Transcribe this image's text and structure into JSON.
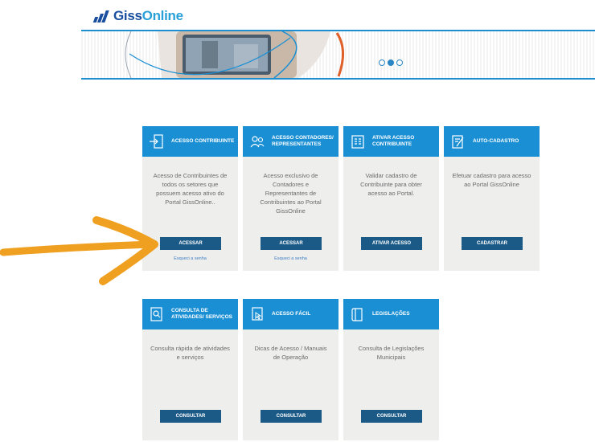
{
  "logo": {
    "brand_a": "Giss",
    "brand_b": "Online"
  },
  "carousel": {
    "slides": 3,
    "active_slide": 2
  },
  "cards": [
    {
      "title": "ACESSO CONTRIBUINTE",
      "desc": "Acesso de Contribuintes de todos os setores que possuem acesso ativo do Portal GissOnline..",
      "button": "ACESSAR",
      "link": "Esqueci a senha",
      "icon": "login-door-icon"
    },
    {
      "title": "ACESSO CONTADORES/ REPRESENTANTES",
      "desc": "Acesso exclusivo de Contadores e Representantes de Contribuintes ao Portal GissOnline",
      "button": "ACESSAR",
      "link": "Esqueci a senha",
      "icon": "users-icon"
    },
    {
      "title": "ATIVAR ACESSO CONTRIBUINTE",
      "desc": "Validar cadastro de Contribuinte para obter acesso ao Portal.",
      "button": "ATIVAR ACESSO",
      "link": "",
      "icon": "building-icon"
    },
    {
      "title": "AUTO-CADASTRO",
      "desc": "Efetuar cadastro para acesso ao Portal GissOnline",
      "button": "CADASTRAR",
      "link": "",
      "icon": "form-edit-icon"
    },
    {
      "title": "CONSULTA DE ATIVIDADES/ SERVIÇOS",
      "desc": "Consulta rápida de atividades e serviços",
      "button": "CONSULTAR",
      "link": "",
      "icon": "search-doc-icon"
    },
    {
      "title": "ACESSO FÁCIL",
      "desc": "Dicas de Acesso / Manuais de Operação",
      "button": "CONSULTAR",
      "link": "",
      "icon": "pointer-doc-icon"
    },
    {
      "title": "LEGISLAÇÕES",
      "desc": "Consulta de Legislações Municipais",
      "button": "CONSULTAR",
      "link": "",
      "icon": "law-book-icon"
    }
  ],
  "annotation": {
    "icon": "orange-arrow-icon",
    "color": "#f0a020"
  }
}
